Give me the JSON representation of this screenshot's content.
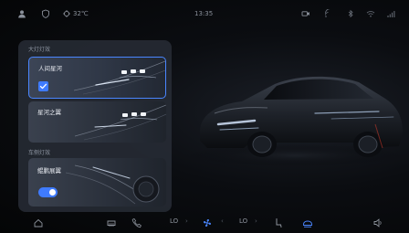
{
  "status_bar": {
    "temperature": "32℃",
    "time": "13:35"
  },
  "panel": {
    "headlight_section_title": "大灯灯效",
    "headlight_effects": [
      {
        "label": "人间星河",
        "selected": true
      },
      {
        "label": "星河之翼",
        "selected": false
      }
    ],
    "side_light_section_title": "车侧灯效",
    "side_light_effect": {
      "label": "鲲鹏展翼",
      "enabled": true
    }
  },
  "dock": {
    "left_temp": "LO",
    "right_temp": "LO"
  },
  "colors": {
    "accent": "#3f7bff",
    "selected_border": "#4a86ff",
    "panel_bg": "#2a303a",
    "text_muted": "#8e96a3"
  }
}
